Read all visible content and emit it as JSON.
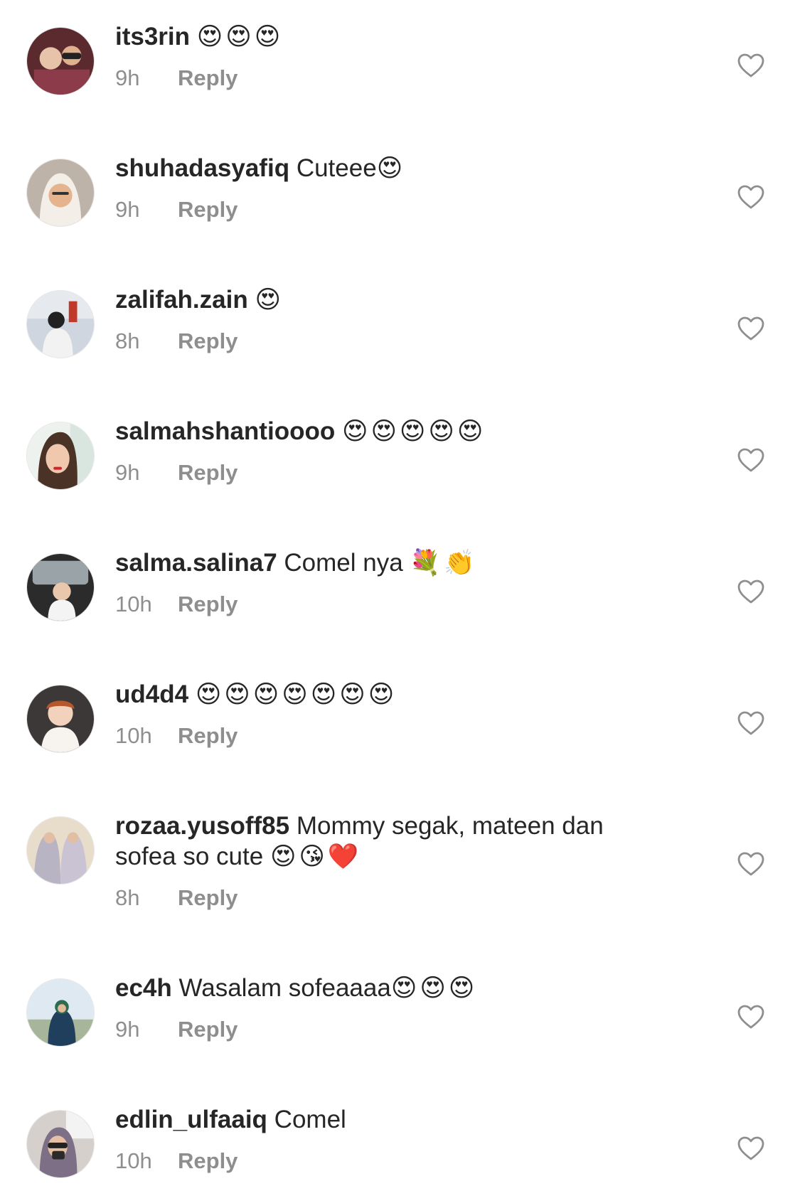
{
  "colors": {
    "username": "#262626",
    "meta": "#8e8e8e",
    "heart_outline": "#8e8e8e",
    "background": "#ffffff"
  },
  "comments": [
    {
      "username": "its3rin",
      "text": "",
      "emoji": "😍😍😍",
      "time": "9h",
      "reply": "Reply",
      "avatar_icon": "avatar-photo",
      "like_icon": "heart-outline-icon"
    },
    {
      "username": "shuhadasyafiq",
      "text": "Cuteee",
      "emoji": "😍",
      "time": "9h",
      "reply": "Reply",
      "avatar_icon": "avatar-photo",
      "like_icon": "heart-outline-icon"
    },
    {
      "username": "zalifah.zain",
      "text": "",
      "emoji": "😍",
      "time": "8h",
      "reply": "Reply",
      "avatar_icon": "avatar-photo",
      "like_icon": "heart-outline-icon"
    },
    {
      "username": "salmahshantioooo",
      "text": "",
      "emoji": "😍😍😍😍😍",
      "time": "9h",
      "reply": "Reply",
      "avatar_icon": "avatar-photo",
      "like_icon": "heart-outline-icon"
    },
    {
      "username": "salma.salina7",
      "text": "Comel nya",
      "emoji": "💐👏",
      "time": "10h",
      "reply": "Reply",
      "avatar_icon": "avatar-photo",
      "like_icon": "heart-outline-icon"
    },
    {
      "username": "ud4d4",
      "text": "",
      "emoji": "😍😍😍😍😍😍😍",
      "time": "10h",
      "reply": "Reply",
      "avatar_icon": "avatar-photo",
      "like_icon": "heart-outline-icon"
    },
    {
      "username": "rozaa.yusoff85",
      "text": "Mommy segak, mateen dan sofea so cute",
      "emoji": "😍😘❤️",
      "time": "8h",
      "reply": "Reply",
      "avatar_icon": "avatar-photo",
      "like_icon": "heart-outline-icon"
    },
    {
      "username": "ec4h",
      "text": "Wasalam sofeaaaa",
      "emoji": "😍😍😍",
      "time": "9h",
      "reply": "Reply",
      "avatar_icon": "avatar-photo",
      "like_icon": "heart-outline-icon"
    },
    {
      "username": "edlin_ulfaaiq",
      "text": "Comel",
      "emoji": "",
      "time": "10h",
      "reply": "Reply",
      "avatar_icon": "avatar-photo",
      "like_icon": "heart-outline-icon"
    }
  ]
}
